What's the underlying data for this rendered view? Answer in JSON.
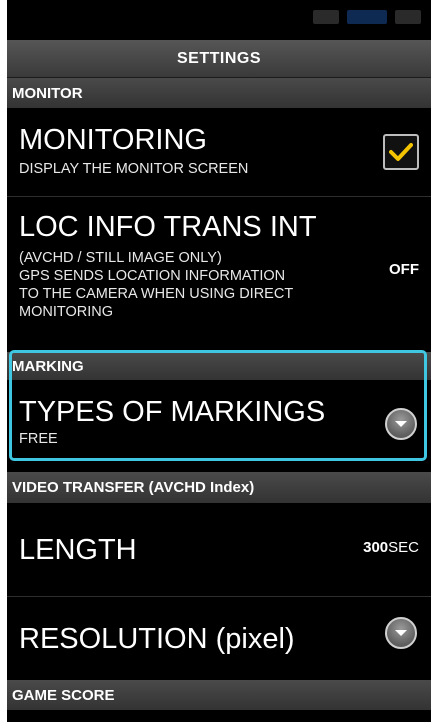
{
  "status_bar": {
    "icons": [
      "signal-icon",
      "wifi-icon",
      "battery-icon"
    ]
  },
  "header": {
    "title": "SETTINGS"
  },
  "sections": {
    "monitor": {
      "label": "MONITOR",
      "monitoring": {
        "title": "MONITORING",
        "description": "DISPLAY THE MONITOR SCREEN",
        "checked": true
      },
      "loc_info": {
        "title": "LOC INFO TRANS INT",
        "description_lines": [
          "(AVCHD / STILL IMAGE ONLY)",
          "GPS SENDS LOCATION INFORMATION",
          "TO THE CAMERA WHEN USING DIRECT",
          "MONITORING"
        ],
        "value": "OFF"
      }
    },
    "marking": {
      "label": "MARKING",
      "types": {
        "title": "TYPES OF MARKINGS",
        "value": "FREE"
      }
    },
    "video_transfer": {
      "label": "VIDEO TRANSFER (AVCHD Index)",
      "length": {
        "title": "LENGTH",
        "value_number": "300",
        "value_unit": "SEC"
      },
      "resolution": {
        "title": "RESOLUTION (pixel)"
      }
    },
    "game_score": {
      "label": "GAME SCORE"
    }
  },
  "colors": {
    "highlight": "#3fc6e0",
    "check": "#f5c400",
    "background": "#000000",
    "header_bg": "#444444"
  }
}
